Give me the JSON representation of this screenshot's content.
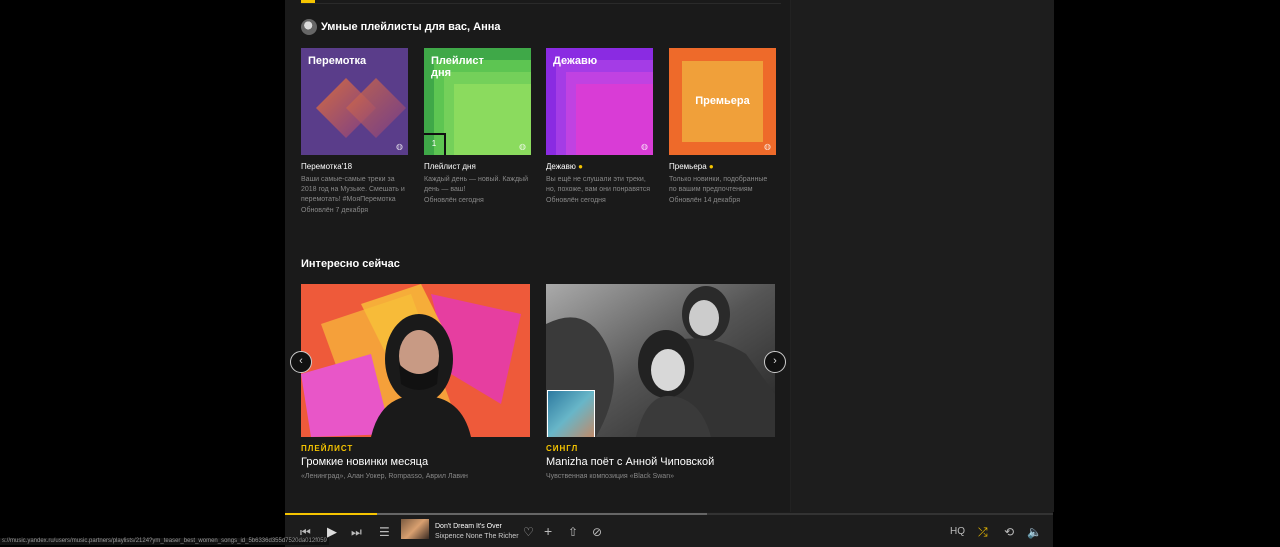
{
  "smart": {
    "title": "Умные плейлисты для вас, Анна",
    "cards": [
      {
        "cover_label": "Перемотка",
        "name": "Перемотка'18",
        "dot": "",
        "desc": "Ваши самые-самые треки за 2018 год на Музыке. Смешать и перемотать! #МояПеремотка",
        "updated": "Обновлён 7 декабря"
      },
      {
        "cover_label": "Плейлист дня",
        "badge": "1",
        "name": "Плейлист дня",
        "dot": "",
        "desc": "Каждый день — новый. Каждый день — ваш!",
        "updated": "Обновлён сегодня"
      },
      {
        "cover_label": "Дежавю",
        "name": "Дежавю",
        "dot": "●",
        "desc": "Вы ещё не слушали эти треки, но, похоже, вам они понравятся",
        "updated": "Обновлён сегодня"
      },
      {
        "cover_label": "Премьера",
        "name": "Премьера",
        "dot": "●",
        "desc": "Только новинки, подобранные по вашим предпочтениям",
        "updated": "Обновлён 14 декабря"
      }
    ]
  },
  "interesting": {
    "title": "Интересно сейчас",
    "items": [
      {
        "type": "ПЛЕЙЛИСТ",
        "title": "Громкие новинки месяца",
        "subtitle": "«Ленинград», Алан Уокер, Rompasso, Аврил Лавин"
      },
      {
        "type": "СИНГЛ",
        "title": "Manizha поёт с Анной Чиповской",
        "subtitle": "Чувственная композиция «Black Swan»"
      }
    ],
    "prev_icon": "‹",
    "next_icon": "›"
  },
  "player": {
    "track_title": "Don't Dream It's Over",
    "track_artist": "Sixpence None The Richer",
    "hq_label": "HQ",
    "progress": 0.12,
    "buffered": 0.55
  },
  "status_url": "s://music.yandex.ru/users/music.partners/playlists/2124?ym_teaser_best_women_songs_id_5b6336d355d7520da012f059",
  "colors": {
    "accent": "#f5c400"
  }
}
